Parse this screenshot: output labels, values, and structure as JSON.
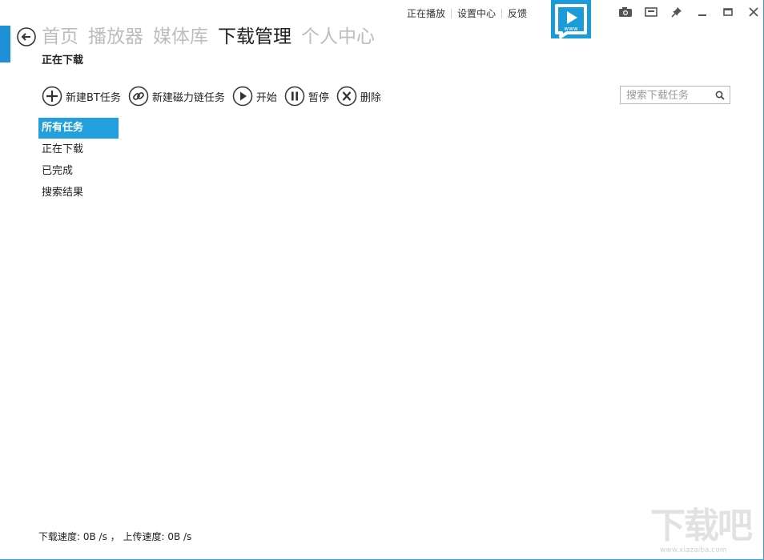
{
  "top_links": [
    "正在播放",
    "设置中心",
    "反馈"
  ],
  "logo_text": "www",
  "icons": {
    "back": "back-arrow-icon",
    "screenshot": "camera-icon",
    "mini": "mini-mode-icon",
    "pin": "pin-icon",
    "minimize": "minimize-icon",
    "maximize": "maximize-icon",
    "close": "close-icon",
    "search": "search-icon"
  },
  "nav": {
    "tabs": [
      {
        "label": "首页",
        "active": false
      },
      {
        "label": "播放器",
        "active": false
      },
      {
        "label": "媒体库",
        "active": false
      },
      {
        "label": "下载管理",
        "active": true
      },
      {
        "label": "个人中心",
        "active": false
      }
    ]
  },
  "section_title": "正在下载",
  "toolbar": {
    "new_bt": "新建BT任务",
    "new_magnet": "新建磁力链任务",
    "start": "开始",
    "pause": "暂停",
    "delete": "删除"
  },
  "search": {
    "placeholder": "搜索下载任务",
    "value": ""
  },
  "sidebar": {
    "items": [
      {
        "label": "所有任务",
        "active": true
      },
      {
        "label": "正在下载",
        "active": false
      },
      {
        "label": "已完成",
        "active": false
      },
      {
        "label": "搜索结果",
        "active": false
      }
    ]
  },
  "status": {
    "text": "下载速度: 0B /s ， 上传速度: 0B /s"
  },
  "watermark": {
    "main": "下载吧",
    "sub": "www.xiazaiba.com"
  },
  "colors": {
    "accent": "#21a0dd",
    "inactive_tab": "#bdbdbd",
    "active_tab": "#1f1f1f"
  }
}
